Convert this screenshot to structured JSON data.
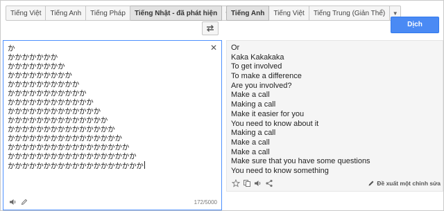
{
  "source_tabs": [
    "Tiếng Việt",
    "Tiếng Anh",
    "Tiếng Pháp",
    "Tiếng Nhật - đã phát hiện"
  ],
  "source_active_index": 3,
  "target_tabs": [
    "Tiếng Anh",
    "Tiếng Việt",
    "Tiếng Trung (Giản Thể)"
  ],
  "target_active_index": 0,
  "translate_label": "Dịch",
  "source_lines": [
    "か",
    "かかかかかかか",
    "かかかかかかかか",
    "かかかかかかかかか",
    "かかかかかかかかかか",
    "かかかかかかかかかかか",
    "かかかかかかかかかかかか",
    "かかかかかかかかかかかかか",
    "かかかかかかかかかかかかかか",
    "かかかかかかかかかかかかかかか",
    "かかかかかかかかかかかかかかかか",
    "かかかかかかかかかかかかかかかかか",
    "かかかかかかかかかかかかかかかかかか",
    "かかかかかかかかかかかかかかかかかかか"
  ],
  "char_count": "172/5000",
  "target_lines": [
    "Or",
    "Kaka Kakakaka",
    "To get involved",
    "To make a difference",
    "Are you involved?",
    "Make a call",
    "Making a call",
    "Make it easier for you",
    "You need to know about it",
    "Making a call",
    "Make a call",
    "Make a call",
    "Make sure that you have some questions",
    "You need to know something"
  ],
  "suggest_label": "Đề xuất một chỉnh sửa",
  "icons": {
    "dropdown": "chevron-down-icon",
    "swap": "swap-icon",
    "clear": "close-icon",
    "speaker": "speaker-icon",
    "pencil": "pencil-icon",
    "star": "star-icon",
    "copy": "copy-icon",
    "share": "share-icon"
  },
  "colors": {
    "accent": "#4a8af4",
    "focus_border": "#4d90fe"
  }
}
